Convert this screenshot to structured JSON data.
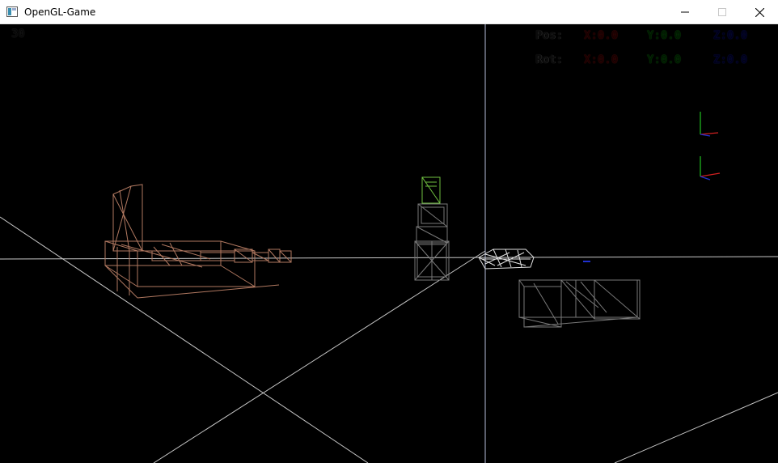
{
  "window": {
    "title": "OpenGL-Game",
    "icon": "app-window-icon",
    "controls": [
      "minimize-icon",
      "maximize-icon",
      "close-icon"
    ]
  },
  "hud": {
    "fps": "30",
    "pos": {
      "label": "Pos:",
      "x": "X:0.0",
      "y": "Y:0.0",
      "z": "Z:0.0"
    },
    "rot": {
      "label": "Rot:",
      "x": "X:0.0",
      "y": "Y:0.0",
      "z": "Z:0.0"
    }
  },
  "colors": {
    "background": "#000000",
    "ground_lines": "#c8c8c8",
    "axis_vertical": "#b4bcd8",
    "wireframe_brown": "#b07860",
    "wireframe_gray": "#787878",
    "wireframe_green": "#70c040",
    "axis_x": "#d02020",
    "axis_y": "#20c020",
    "axis_z": "#2030d0"
  }
}
